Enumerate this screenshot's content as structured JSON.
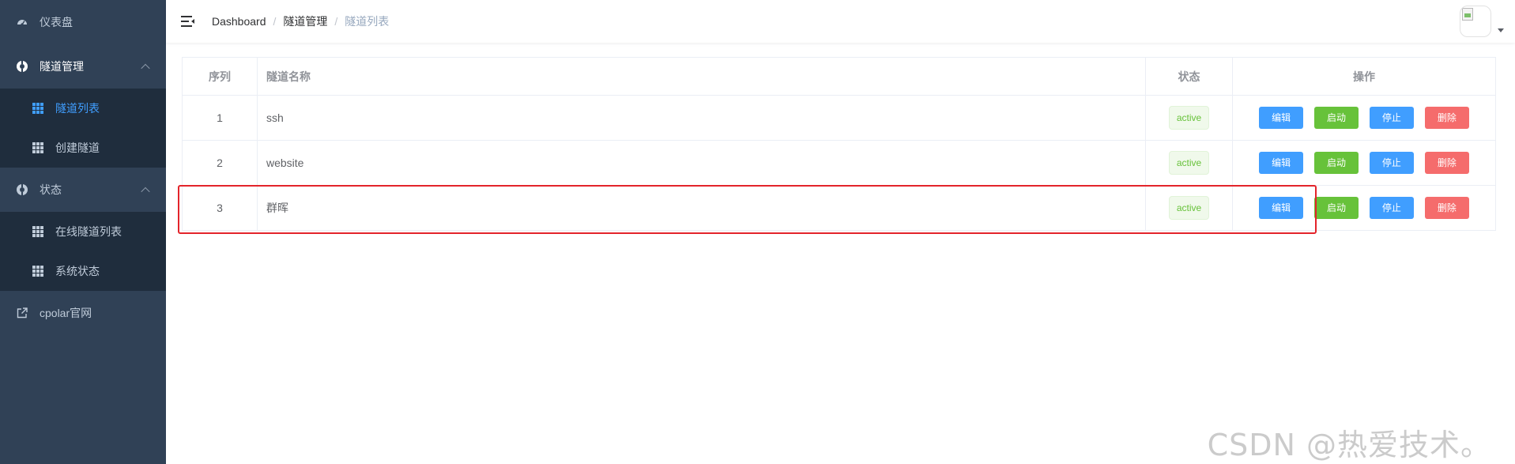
{
  "sidebar": {
    "dashboard": "仪表盘",
    "tunnel_mgmt": "隧道管理",
    "tunnel_list": "隧道列表",
    "create_tunnel": "创建隧道",
    "status": "状态",
    "online_tunnels": "在线隧道列表",
    "system_status": "系统状态",
    "cpolar_site": "cpolar官网"
  },
  "breadcrumb": [
    "Dashboard",
    "隧道管理",
    "隧道列表"
  ],
  "table": {
    "headers": {
      "index": "序列",
      "name": "隧道名称",
      "state": "状态",
      "ops": "操作"
    },
    "rows": [
      {
        "index": "1",
        "name": "ssh",
        "state": "active"
      },
      {
        "index": "2",
        "name": "website",
        "state": "active"
      },
      {
        "index": "3",
        "name": "群晖",
        "state": "active"
      }
    ],
    "buttons": {
      "edit": "编辑",
      "start": "启动",
      "stop": "停止",
      "delete": "删除"
    }
  },
  "colors": {
    "sidebar_bg": "#304156",
    "submenu_bg": "#1f2d3d",
    "accent": "#409eff",
    "success": "#67c23a",
    "danger": "#f56c6c",
    "annotation": "#e3242b"
  },
  "watermark": "CSDN @热爱技术。"
}
